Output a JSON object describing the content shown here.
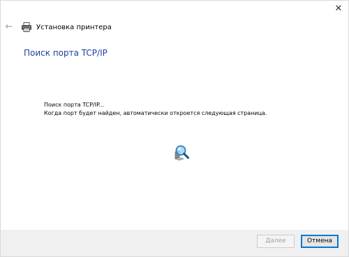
{
  "window": {
    "close_glyph": "✕"
  },
  "nav": {
    "back_glyph": "←"
  },
  "header": {
    "title": "Установка принтера",
    "icon": "printer-icon"
  },
  "page": {
    "heading": "Поиск порта TCP/IP",
    "status_line1": "Поиск порта TCP/IP...",
    "status_line2": "Когда порт будет найден, автоматически откроется следующая страница.",
    "progress_icon": "search-magnifier-icon"
  },
  "footer": {
    "next_label": "Далее",
    "next_enabled": false,
    "cancel_label": "Отмена"
  },
  "colors": {
    "heading": "#1e3e9c",
    "footer_bg": "#f0f0f0",
    "focus_border": "#0078d7"
  }
}
